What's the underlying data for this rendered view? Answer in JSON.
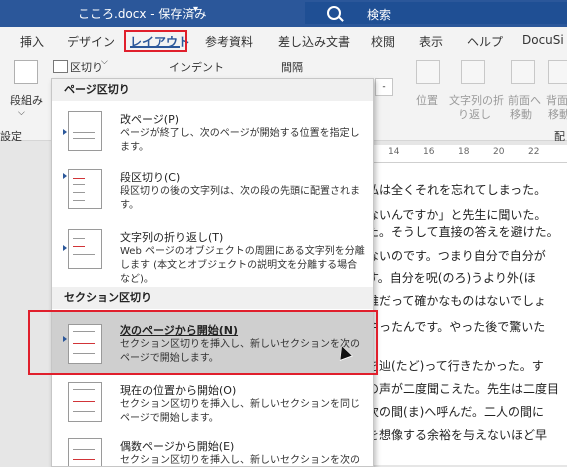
{
  "titlebar": {
    "doc_title": "こころ.docx - 保存済み",
    "caret": "▾",
    "search_label": "検索"
  },
  "tabs": [
    "挿入",
    "デザイン",
    "レイアウト",
    "参考資料",
    "差し込み文書",
    "校閲",
    "表示",
    "ヘルプ",
    "DocuSi"
  ],
  "ribbon": {
    "section_break_label": "区切り",
    "section_break_caret": "⌵",
    "indent_label": "インデント",
    "spacing_label": "間隔",
    "columns_label": "段組み",
    "columns_caret": "⌵",
    "setup_group_fragment": "設定",
    "position_label": "位置",
    "wrap_label_1": "文字列の折",
    "wrap_label_2": "り返し",
    "forward_label_1": "前面へ",
    "forward_label_2": "移動",
    "backward_label_1": "背面",
    "backward_label_2": "移動",
    "arrange_fragment": "配",
    "ruler_input_value": "-"
  },
  "ruler": {
    "ticks": [
      "14",
      "16",
      "18",
      "20",
      "22"
    ]
  },
  "document": {
    "lines": [
      "私は全くそれを忘れてしまった。",
      "ないんですか」と先生に聞いた。",
      "た。そうして直接の答えを避けた。",
      "ないのです。つまり自分で自分が",
      "す。自分を呪(のろ)うより外(ほ",
      "誰だって確かなものはないでしょ",
      "やったんです。やった後で驚いた",
      "を辿(たど)って行きたかった。す",
      "の声が二度聞こえた。先生は二度目",
      "次の間(ま)へ呼んだ。二人の間に",
      "を想像する余裕を与えないほど早"
    ]
  },
  "menu": {
    "page_breaks_header": "ページ区切り",
    "section_breaks_header": "セクション区切り",
    "items": [
      {
        "title": "改ページ(P)",
        "desc": "ページが終了し、次のページが開始する位置を指定します。"
      },
      {
        "title": "段区切り(C)",
        "desc": "段区切りの後の文字列は、次の段の先頭に配置されます。"
      },
      {
        "title": "文字列の折り返し(T)",
        "desc": "Web ページのオブジェクトの周囲にある文字列を分離します (本文とオブジェクトの説明文を分離する場合など)。"
      },
      {
        "title": "次のページから開始(N)",
        "desc": "セクション区切りを挿入し、新しいセクションを次のページで開始します。"
      },
      {
        "title": "現在の位置から開始(O)",
        "desc": "セクション区切りを挿入し、新しいセクションを同じページで開始します。"
      },
      {
        "title": "偶数ページから開始(E)",
        "desc": "セクション区切りを挿入し、新しいセクションを次の偶数"
      }
    ]
  },
  "colors": {
    "title_bar": "#2b579a",
    "accent": "#2b579a",
    "highlight_box": "#e01f2c",
    "selected_item_bg": "#cfcfcf"
  }
}
